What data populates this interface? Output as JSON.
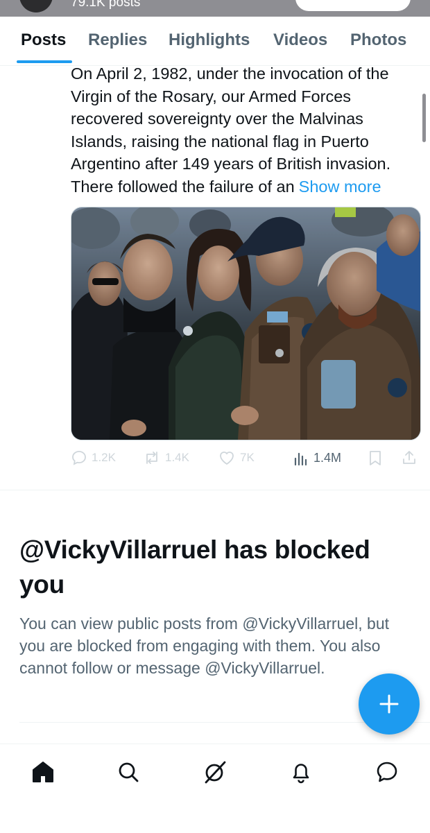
{
  "header": {
    "post_count": "79.1K posts"
  },
  "tabs": [
    {
      "label": "Posts",
      "active": true
    },
    {
      "label": "Replies",
      "active": false
    },
    {
      "label": "Highlights",
      "active": false
    },
    {
      "label": "Videos",
      "active": false
    },
    {
      "label": "Photos",
      "active": false
    }
  ],
  "tweet": {
    "lines": [
      "On April 2, 1982, under the invocation of the",
      "Virgin of the Rosary, our Armed Forces",
      "recovered sovereignty over the Malvinas",
      "Islands, raising the national flag in Puerto",
      "Argentino after 149 years of British invasion.",
      "There followed the failure of an"
    ],
    "show_more": "Show more",
    "stats": {
      "replies": "1.2K",
      "reposts": "1.4K",
      "likes": "7K",
      "views": "1.4M"
    }
  },
  "blocked": {
    "title": "@VickyVillarruel has blocked you",
    "body": "You can view public posts from @VickyVillarruel, but you are blocked from engaging with them. You also cannot follow or message @VickyVillarruel."
  },
  "icons": {
    "reply": "reply-icon",
    "repost": "repost-icon",
    "like": "heart-icon",
    "views": "views-icon",
    "bookmark": "bookmark-icon",
    "share": "share-icon",
    "compose": "plus-icon",
    "home": "home-icon",
    "search": "search-icon",
    "grok": "grok-icon",
    "notifications": "bell-icon",
    "messages": "message-icon"
  },
  "colors": {
    "accent": "#1d9bf0",
    "text_primary": "#0f1419",
    "text_secondary": "#536471"
  }
}
